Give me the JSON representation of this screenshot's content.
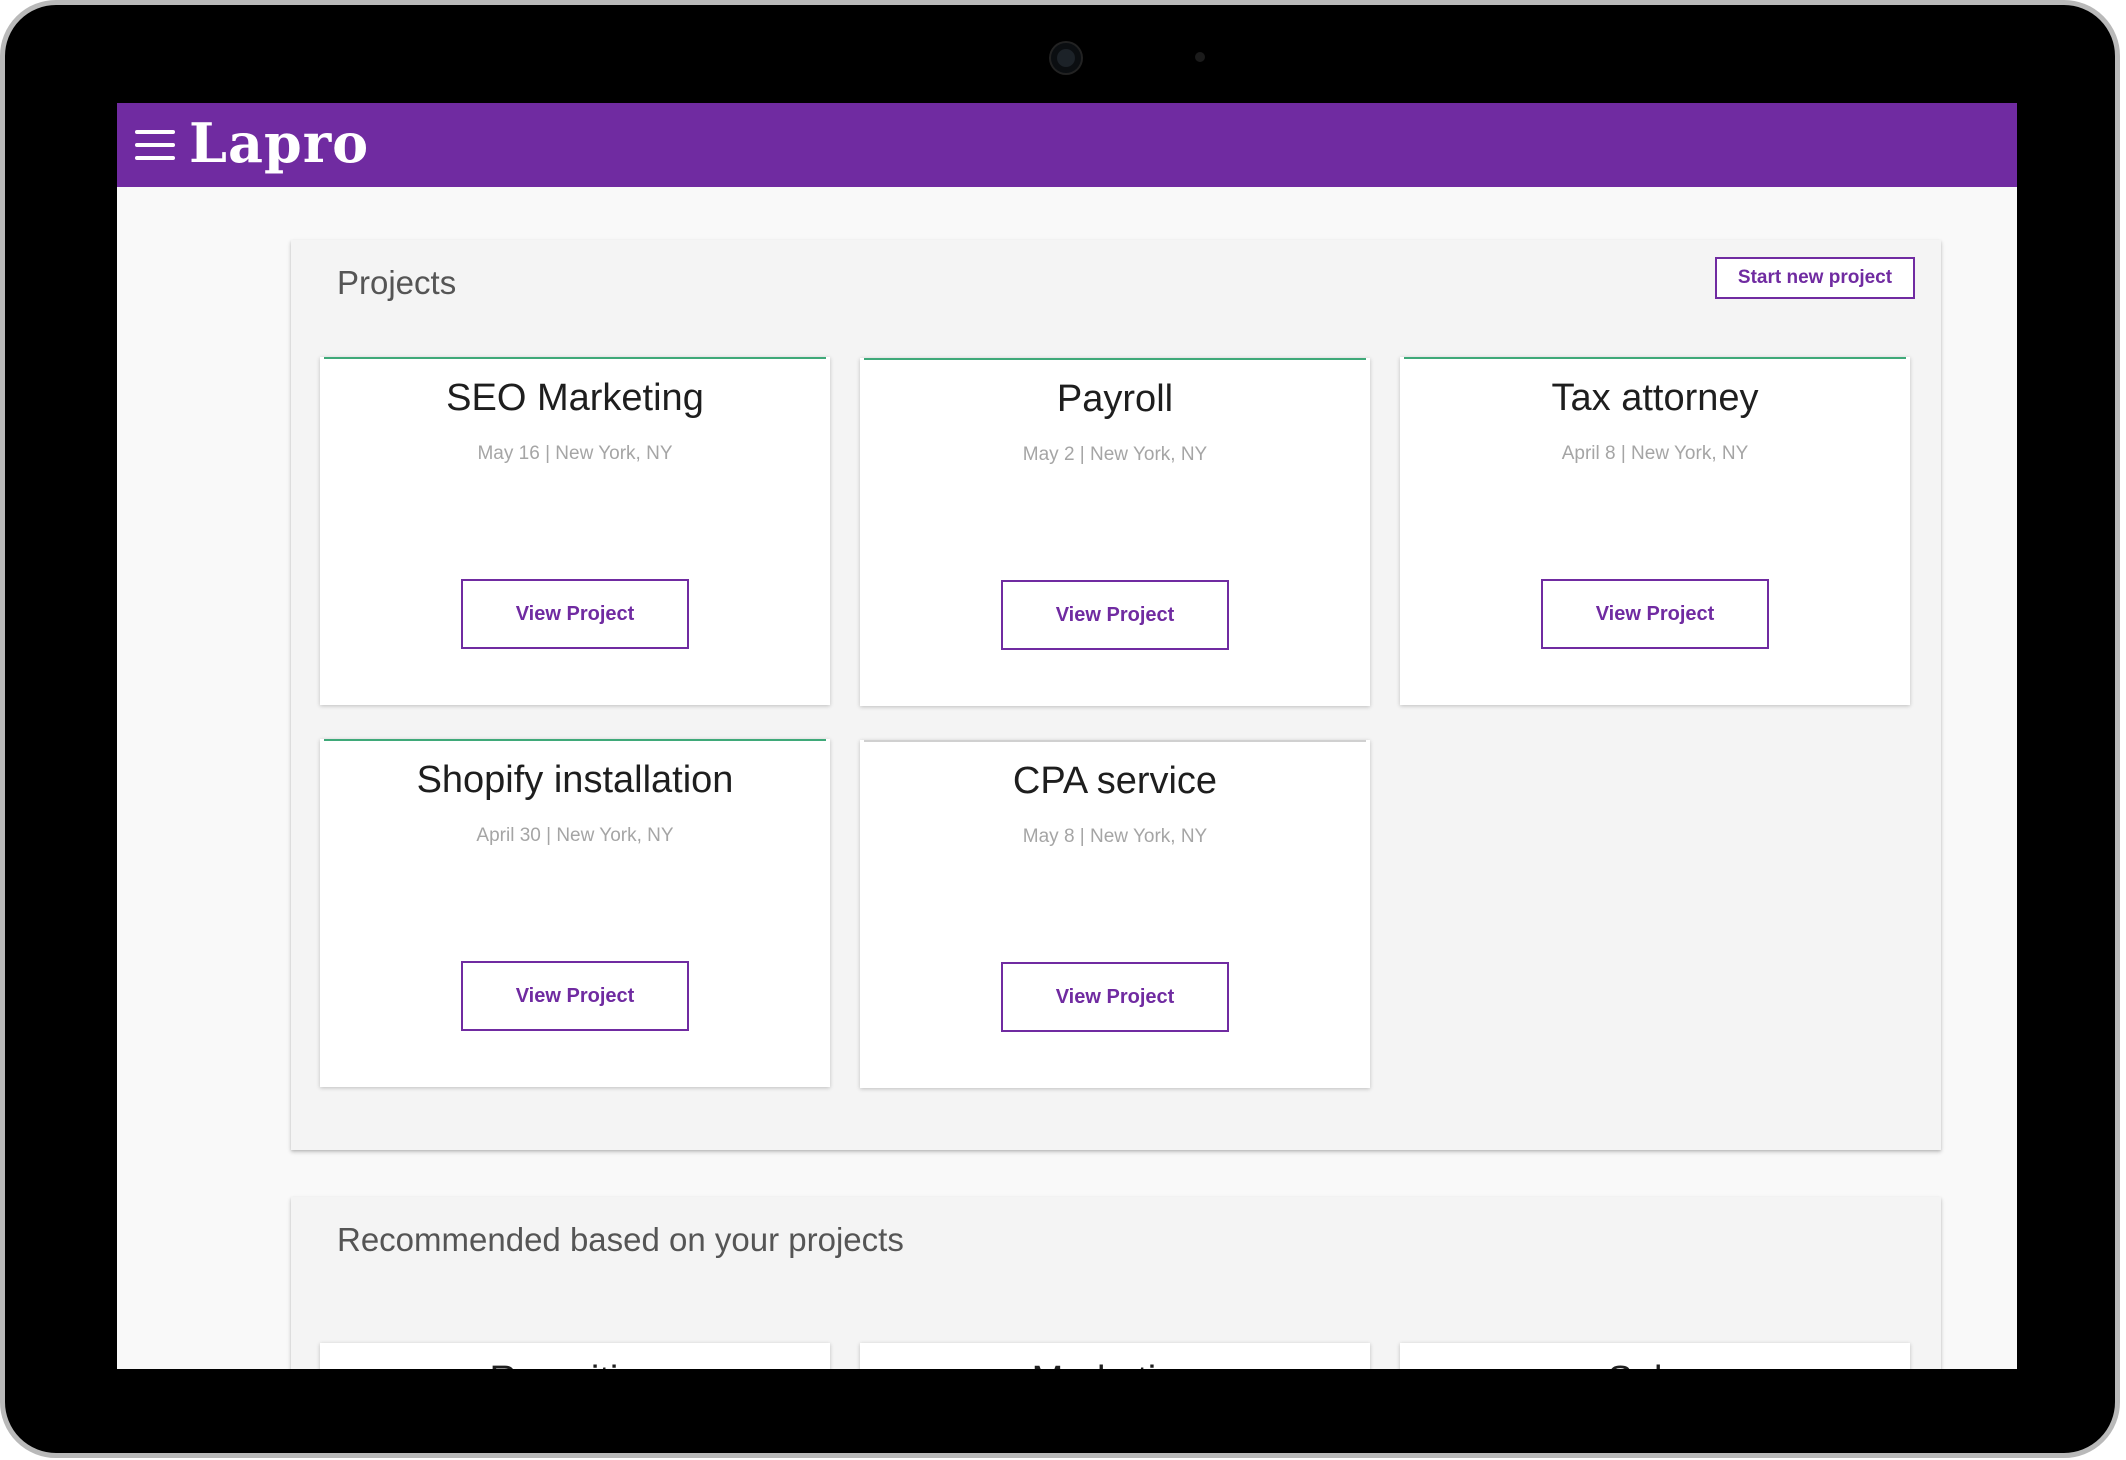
{
  "app": {
    "brand": "Lapro"
  },
  "colors": {
    "accent": "#702ba1",
    "card_top_green": "#3fa979",
    "card_top_gray": "#d0d0d0"
  },
  "projects_panel": {
    "title": "Projects",
    "start_button": "Start new project",
    "cards": [
      {
        "title": "SEO Marketing",
        "meta": "May 16 | New York, NY",
        "button": "View Project"
      },
      {
        "title": "Payroll",
        "meta": "May 2 | New York, NY",
        "button": "View Project"
      },
      {
        "title": "Tax attorney",
        "meta": "April 8 | New York, NY",
        "button": "View Project"
      },
      {
        "title": "Shopify installation",
        "meta": "April 30 | New York, NY",
        "button": "View Project"
      },
      {
        "title": "CPA service",
        "meta": "May 8 | New York, NY",
        "button": "View Project"
      }
    ]
  },
  "recommended_panel": {
    "title": "Recommended based on your projects",
    "cards": [
      {
        "title": "Recruiting"
      },
      {
        "title": "Marketing"
      },
      {
        "title": "Sales"
      }
    ]
  }
}
